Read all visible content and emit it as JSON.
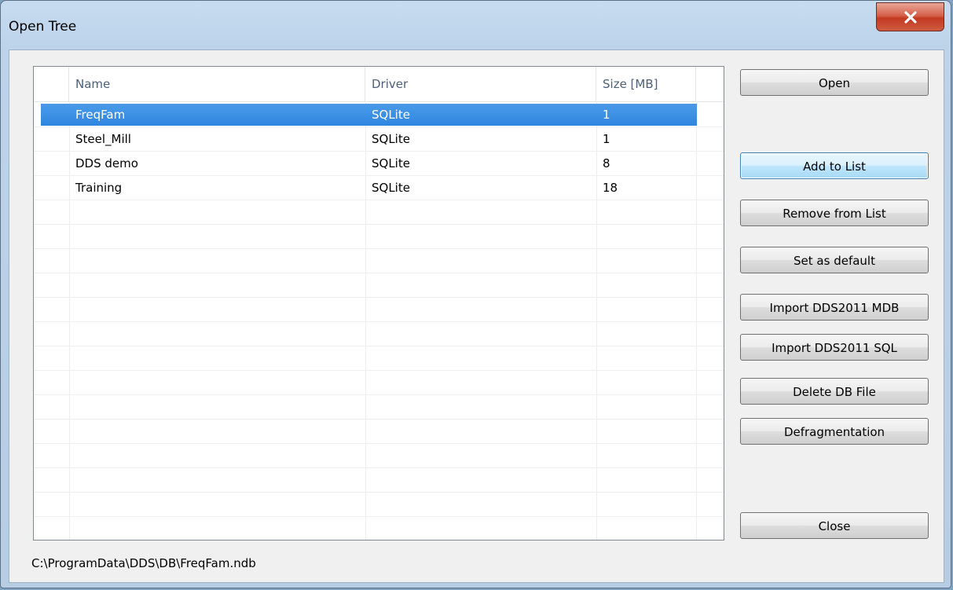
{
  "window": {
    "title": "Open Tree"
  },
  "table": {
    "columns": [
      "Name",
      "Driver",
      "Size [MB]"
    ],
    "rows": [
      {
        "name": "FreqFam",
        "driver": "SQLite",
        "size": "1",
        "selected": true
      },
      {
        "name": "Steel_Mill",
        "driver": "SQLite",
        "size": "1",
        "selected": false
      },
      {
        "name": "DDS demo",
        "driver": "SQLite",
        "size": "8",
        "selected": false
      },
      {
        "name": "Training",
        "driver": "SQLite",
        "size": "18",
        "selected": false
      }
    ]
  },
  "buttons": {
    "open": "Open",
    "add_to_list": "Add to List",
    "remove_from_list": "Remove from List",
    "set_as_default": "Set as default",
    "import_mdb": "Import DDS2011 MDB",
    "import_sql": "Import DDS2011 SQL",
    "delete_db_file": "Delete DB File",
    "defragmentation": "Defragmentation",
    "close": "Close"
  },
  "status": {
    "path": "C:\\ProgramData\\DDS\\DB\\FreqFam.ndb"
  },
  "colors": {
    "selection": "#3390e4",
    "close_button": "#c9472d"
  }
}
